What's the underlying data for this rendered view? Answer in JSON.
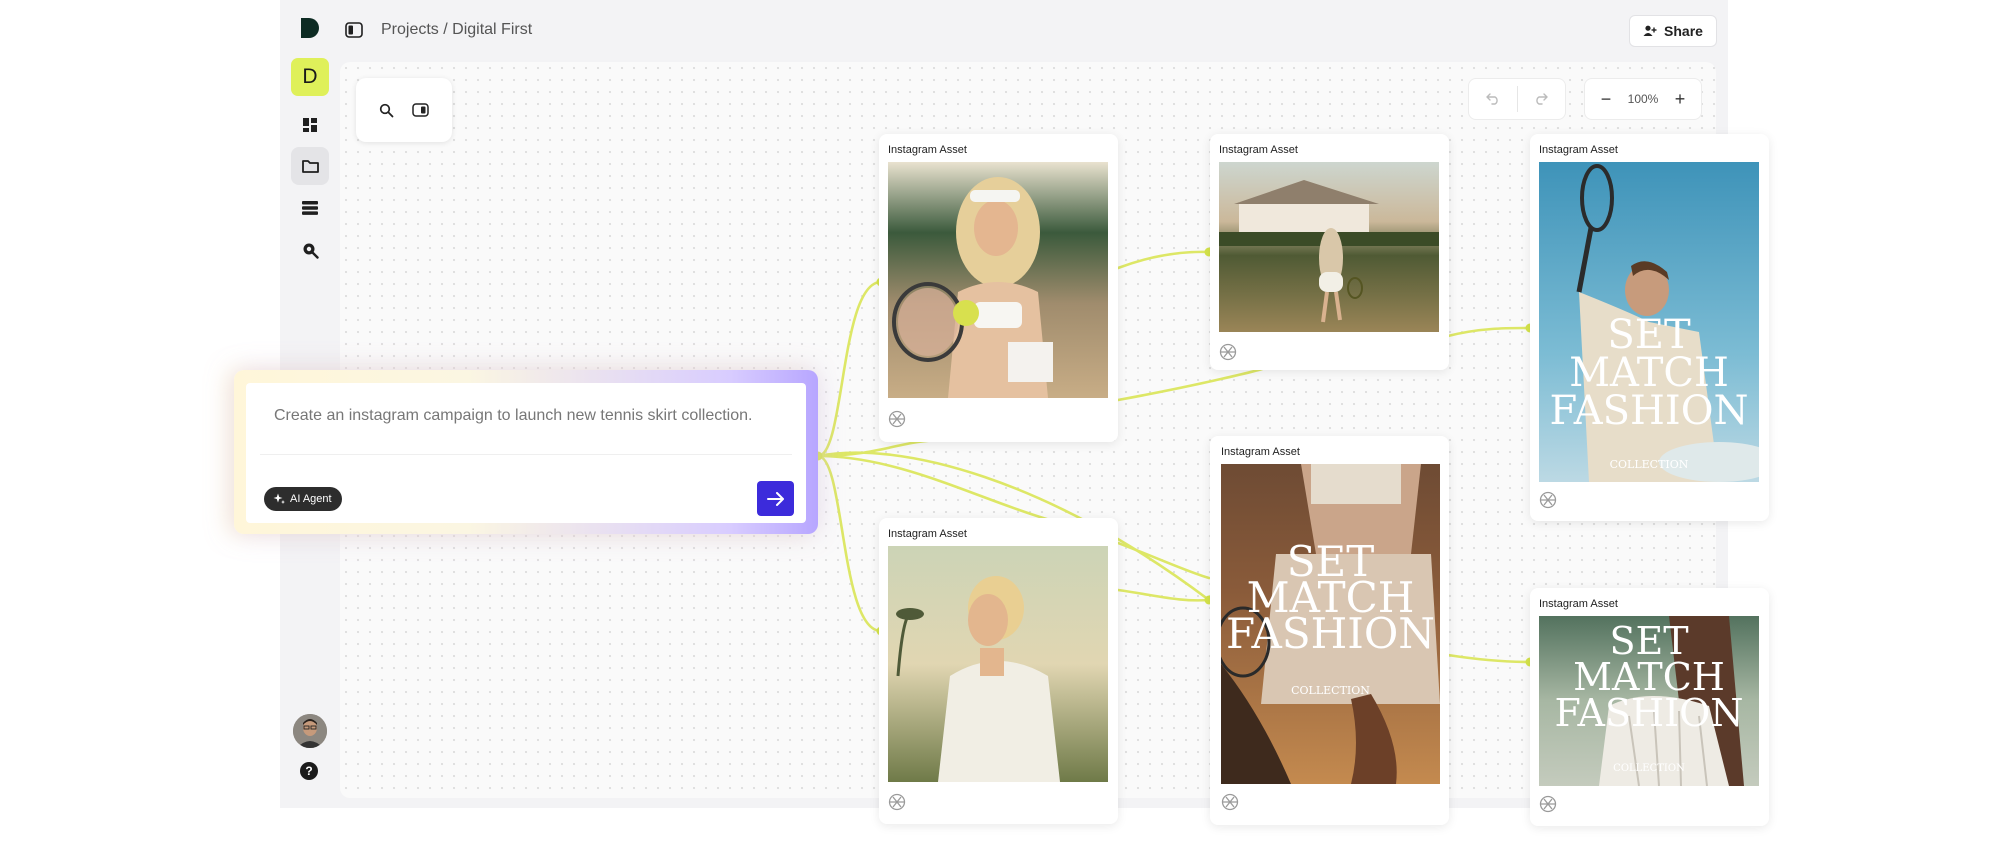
{
  "app": {
    "logo_icon": "d-logo-icon",
    "workspace_initial": "D",
    "breadcrumb": "Projects / Digital First",
    "share_label": "Share",
    "zoom_level": "100%"
  },
  "sidebar": {
    "items": [
      {
        "name": "dashboard",
        "icon": "dashboard-grid-icon"
      },
      {
        "name": "projects",
        "icon": "folder-icon",
        "active": true
      },
      {
        "name": "library",
        "icon": "stack-icon"
      },
      {
        "name": "search",
        "icon": "search-zoom-icon"
      }
    ],
    "help": "?"
  },
  "prompt": {
    "text": "Create an instagram campaign to launch new tennis skirt collection.",
    "agent_label": "AI Agent"
  },
  "assets": [
    {
      "id": "a1",
      "label": "Instagram Asset",
      "image": "woman tennis player with racket and ball"
    },
    {
      "id": "a2",
      "label": "Instagram Asset",
      "image": "player walking on court toward clubhouse"
    },
    {
      "id": "a3",
      "label": "Instagram Asset",
      "image": "blonde player in tennis polo"
    },
    {
      "id": "a4",
      "label": "Instagram Asset",
      "image": "tennis poster",
      "poster": [
        "SET",
        "MATCH",
        "FASHION"
      ],
      "poster_sub": "COLLECTION"
    },
    {
      "id": "a5",
      "label": "Instagram Asset",
      "image": "tennis poster on blue sky",
      "poster": [
        "SET",
        "MATCH",
        "FASHION"
      ],
      "poster_sub": "COLLECTION"
    },
    {
      "id": "a6",
      "label": "Instagram Asset",
      "image": "tennis poster with white skirt",
      "poster": [
        "SET",
        "MATCH",
        "FASHION"
      ],
      "poster_sub": "COLLECTION"
    }
  ],
  "colors": {
    "accent": "#3c2bdb",
    "workspace_badge": "#dff05a",
    "connector": "#dbe858"
  }
}
